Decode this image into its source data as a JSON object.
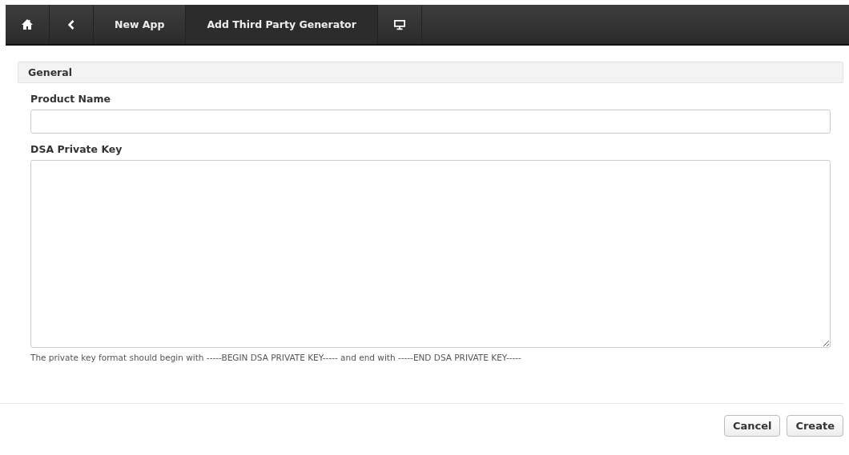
{
  "navbar": {
    "items": [
      {
        "kind": "home",
        "selected": false
      },
      {
        "kind": "back",
        "selected": false
      },
      {
        "kind": "text",
        "label": "New App",
        "selected": false
      },
      {
        "kind": "text",
        "label": "Add Third Party Generator",
        "selected": true
      },
      {
        "kind": "monitor",
        "selected": false
      }
    ]
  },
  "section": {
    "title": "General"
  },
  "fields": [
    {
      "kind": "input",
      "label": "Product Name"
    },
    {
      "kind": "textarea",
      "label": "DSA Private Key",
      "hint": "The private key format should begin with -----BEGIN DSA PRIVATE KEY----- and end with -----END DSA PRIVATE KEY-----"
    }
  ],
  "buttons": [
    "Cancel",
    "Create"
  ]
}
